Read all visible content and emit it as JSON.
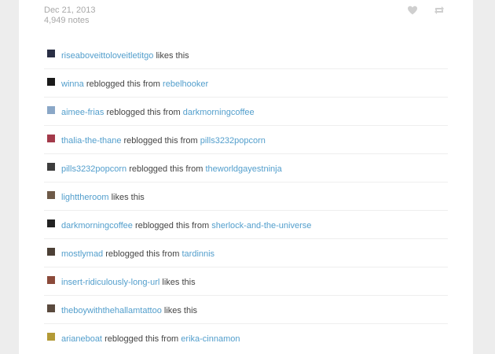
{
  "post": {
    "date": "Dec 21, 2013",
    "notes_count": "4,949 notes"
  },
  "icons": {
    "like": "heart-icon",
    "reblog": "reblog-icon"
  },
  "colors": {
    "link": "#529ecc",
    "icon": "#cfcfcf"
  },
  "notes": [
    {
      "user": "riseaboveittoloveitletitgo",
      "action": "likes this",
      "from": "",
      "avatar_color": "#2a2f45"
    },
    {
      "user": "winna",
      "action": "reblogged this from",
      "from": "rebelhooker",
      "avatar_color": "#1a1a1a"
    },
    {
      "user": "aimee-frias",
      "action": "reblogged this from",
      "from": "darkmorningcoffee",
      "avatar_color": "#8aa7c7"
    },
    {
      "user": "thalia-the-thane",
      "action": "reblogged this from",
      "from": "pills3232popcorn",
      "avatar_color": "#a33a4a"
    },
    {
      "user": "pills3232popcorn",
      "action": "reblogged this from",
      "from": "theworldgayestninja",
      "avatar_color": "#3d3d3d"
    },
    {
      "user": "lighttheroom",
      "action": "likes this",
      "from": "",
      "avatar_color": "#6e5a48"
    },
    {
      "user": "darkmorningcoffee",
      "action": "reblogged this from",
      "from": "sherlock-and-the-universe",
      "avatar_color": "#222222"
    },
    {
      "user": "mostlymad",
      "action": "reblogged this from",
      "from": "tardinnis",
      "avatar_color": "#4c4036"
    },
    {
      "user": "insert-ridiculously-long-url",
      "action": "likes this",
      "from": "",
      "avatar_color": "#8b4a3a"
    },
    {
      "user": "theboywiththehallamtattoo",
      "action": "likes this",
      "from": "",
      "avatar_color": "#5a4a3e"
    },
    {
      "user": "arianeboat",
      "action": "reblogged this from",
      "from": "erika-cinnamon",
      "avatar_color": "#b39a36"
    }
  ]
}
